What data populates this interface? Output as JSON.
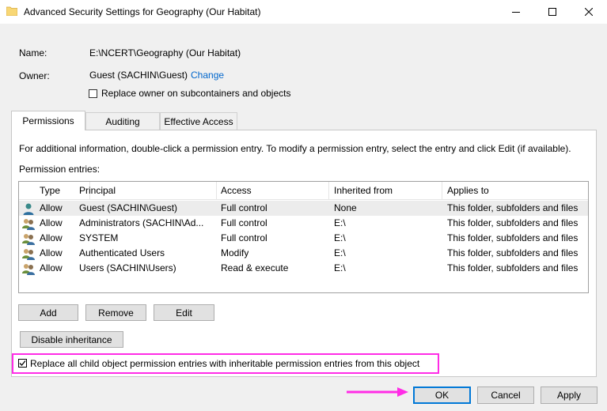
{
  "window": {
    "title": "Advanced Security Settings for Geography (Our Habitat)"
  },
  "info": {
    "name_label": "Name:",
    "name_value": "E:\\NCERT\\Geography (Our Habitat)",
    "owner_label": "Owner:",
    "owner_value": "Guest (SACHIN\\Guest)",
    "change_link": "Change",
    "replace_owner_label": "Replace owner on subcontainers and objects"
  },
  "tabs": [
    {
      "label": "Permissions"
    },
    {
      "label": "Auditing"
    },
    {
      "label": "Effective Access"
    }
  ],
  "permissions": {
    "info_text": "For additional information, double-click a permission entry. To modify a permission entry, select the entry and click Edit (if available).",
    "entries_label": "Permission entries:",
    "columns": [
      "Type",
      "Principal",
      "Access",
      "Inherited from",
      "Applies to"
    ],
    "rows": [
      {
        "type": "Allow",
        "principal": "Guest (SACHIN\\Guest)",
        "access": "Full control",
        "inherited": "None",
        "applies": "This folder, subfolders and files"
      },
      {
        "type": "Allow",
        "principal": "Administrators (SACHIN\\Ad...",
        "access": "Full control",
        "inherited": "E:\\",
        "applies": "This folder, subfolders and files"
      },
      {
        "type": "Allow",
        "principal": "SYSTEM",
        "access": "Full control",
        "inherited": "E:\\",
        "applies": "This folder, subfolders and files"
      },
      {
        "type": "Allow",
        "principal": "Authenticated Users",
        "access": "Modify",
        "inherited": "E:\\",
        "applies": "This folder, subfolders and files"
      },
      {
        "type": "Allow",
        "principal": "Users (SACHIN\\Users)",
        "access": "Read & execute",
        "inherited": "E:\\",
        "applies": "This folder, subfolders and files"
      }
    ],
    "add_button": "Add",
    "remove_button": "Remove",
    "edit_button": "Edit",
    "disable_inheritance_button": "Disable inheritance",
    "replace_child_label": "Replace all child object permission entries with inheritable permission entries from this object",
    "replace_child_checked": true
  },
  "footer": {
    "ok": "OK",
    "cancel": "Cancel",
    "apply": "Apply"
  },
  "colors": {
    "highlight": "#ff2ce6",
    "link": "#0066cc",
    "default_button_border": "#0078d7"
  }
}
